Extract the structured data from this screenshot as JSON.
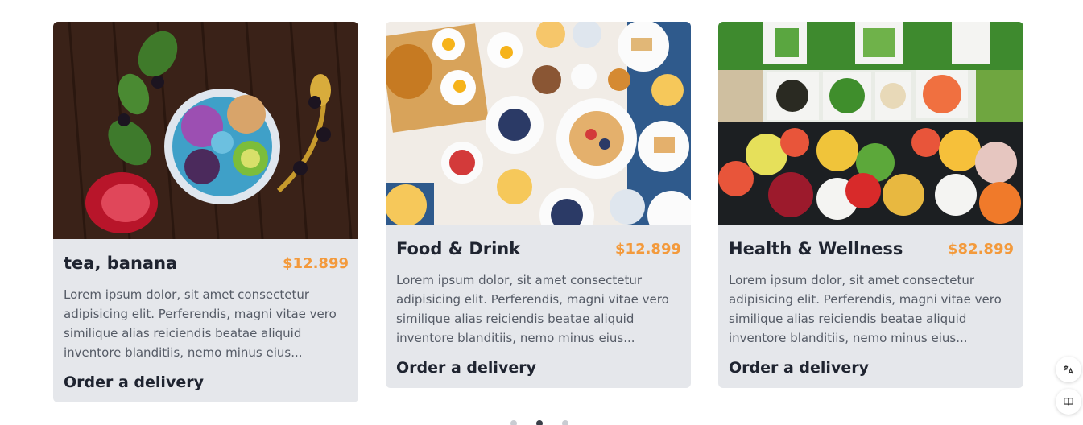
{
  "cards": [
    {
      "title": "tea, banana",
      "price": "$12.899",
      "description": "Lorem ipsum dolor, sit amet consectetur adipisicing elit. Perferendis, magni vitae vero similique alias reiciendis beatae aliquid inventore blanditiis, nemo minus eius...",
      "cta": "Order a delivery",
      "image_icon": "smoothie-bowl-photo"
    },
    {
      "title": "Food & Drink",
      "price": "$12.899",
      "description": "Lorem ipsum dolor, sit amet consectetur adipisicing elit. Perferendis, magni vitae vero similique alias reiciendis beatae aliquid inventore blanditiis, nemo minus eius...",
      "cta": "Order a delivery",
      "image_icon": "breakfast-table-photo"
    },
    {
      "title": "Health & Wellness",
      "price": "$82.899",
      "description": "Lorem ipsum dolor, sit amet consectetur adipisicing elit. Perferendis, magni vitae vero similique alias reiciendis beatae aliquid inventore blanditiis, nemo minus eius...",
      "cta": "Order a delivery",
      "image_icon": "salad-bar-photo"
    }
  ],
  "carousel": {
    "active_index": 1,
    "count": 3
  },
  "floating_buttons": [
    {
      "icon": "translate-icon"
    },
    {
      "icon": "book-icon"
    }
  ],
  "colors": {
    "card_bg": "#e5e7eb",
    "price": "#f39a3c",
    "title": "#1f2430",
    "description": "#555b66"
  }
}
